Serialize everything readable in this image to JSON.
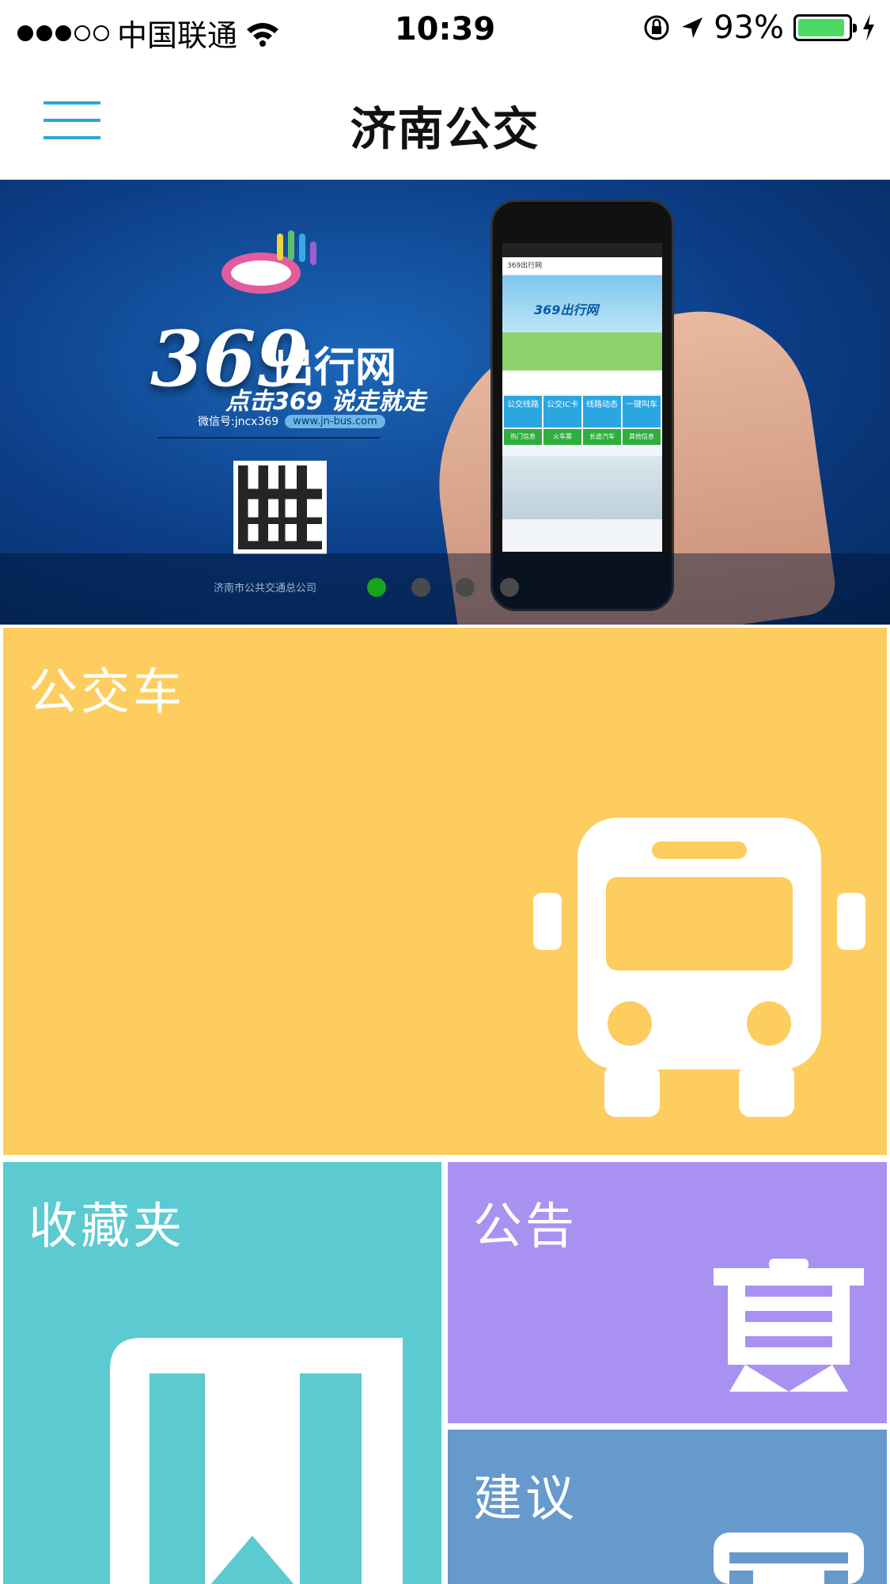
{
  "status_bar": {
    "carrier": "中国联通",
    "time": "10:39",
    "battery": "93%",
    "battery_level": 0.93,
    "signal_bars_filled": 3,
    "signal_bars_total": 5
  },
  "nav": {
    "title": "济南公交",
    "menu_icon": "hamburger-menu-icon"
  },
  "banner": {
    "brand": "369",
    "brand_text": "出行网",
    "slogan": "点击369  说走就走",
    "wechat": "微信号:jncx369",
    "website": "www.jn-bus.com",
    "company": "济南市公共交通总公司",
    "phone_screen": {
      "header": "369出行网",
      "hero": "369出行网",
      "grid": [
        "公交线路",
        "公交IC卡",
        "线路动态",
        "一键叫车"
      ],
      "grid2": [
        "热门信息",
        "火车票",
        "长途汽车",
        "其他信息"
      ]
    },
    "page_count": 4,
    "active_page": 1
  },
  "tiles": {
    "bus": {
      "label": "公交车",
      "icon": "bus-icon",
      "color": "#fdcd5f"
    },
    "favorites": {
      "label": "收藏夹",
      "icon": "bookmark-icon",
      "color": "#5bcad1"
    },
    "notice": {
      "label": "公告",
      "icon": "notice-icon",
      "color": "#a991f1"
    },
    "suggest": {
      "label": "建议",
      "icon": "suggestion-icon",
      "color": "#6699cc"
    }
  },
  "colors": {
    "accent": "#2aa7d8",
    "active_dot": "#17a31a"
  }
}
